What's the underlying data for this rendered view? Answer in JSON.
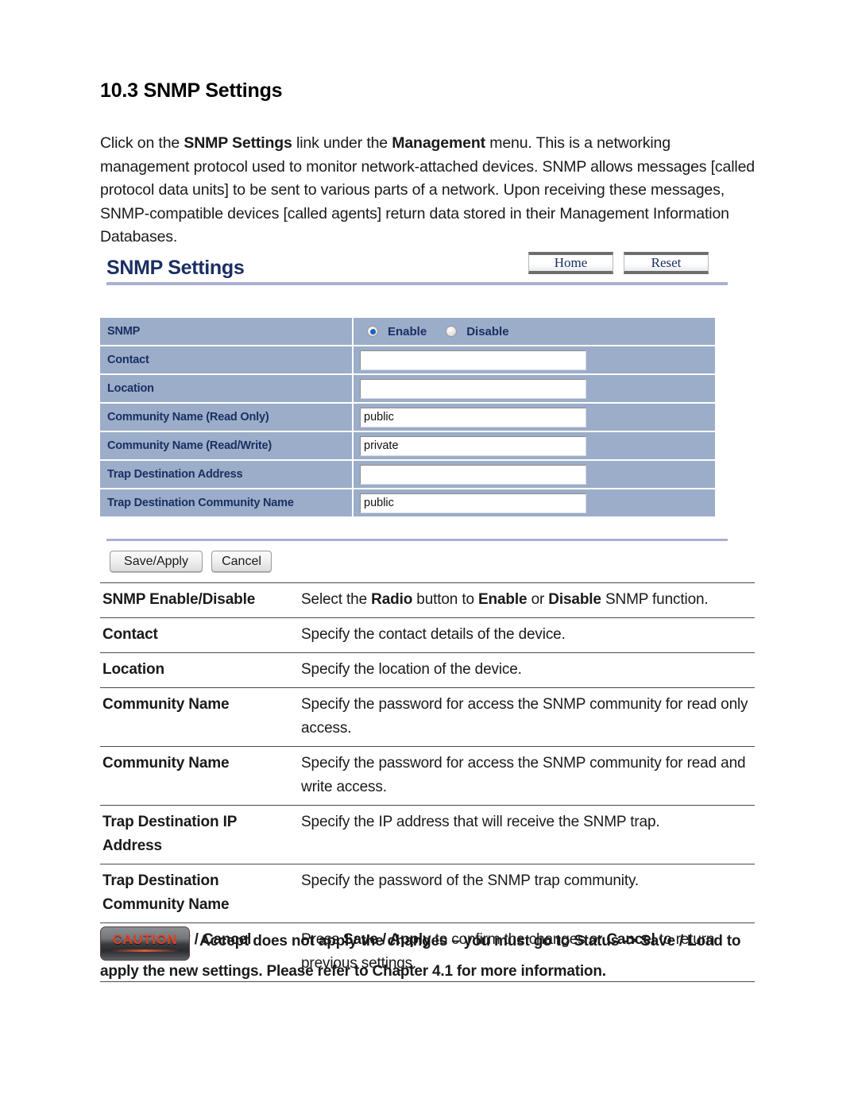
{
  "document": {
    "section_number": "10.3",
    "section_title": "SNMP Settings",
    "heading": "10.3 SNMP Settings",
    "intro_line1_a": "Click on the ",
    "intro_bold1": "SNMP Settings",
    "intro_line1_b": " link under the ",
    "intro_bold2": "Management",
    "intro_line1_c": " menu. This is a networking management protocol used to monitor network-attached devices. SNMP allows messages [called protocol data units] to be sent to various parts of a network. Upon receiving these messages, SNMP-compatible devices [called agents] return data stored in their Management Information Databases."
  },
  "ui": {
    "title": "SNMP Settings",
    "home_button": "Home",
    "reset_button": "Reset",
    "save_button": "Save/Apply",
    "cancel_button": "Cancel",
    "radio": {
      "enable_label": "Enable",
      "disable_label": "Disable",
      "selected": "Enable"
    },
    "rows": [
      {
        "label": "SNMP",
        "type": "radio",
        "value": ""
      },
      {
        "label": "Contact",
        "type": "text",
        "value": ""
      },
      {
        "label": "Location",
        "type": "text",
        "value": ""
      },
      {
        "label": "Community Name (Read Only)",
        "type": "text",
        "value": "public"
      },
      {
        "label": "Community Name (Read/Write)",
        "type": "text",
        "value": "private"
      },
      {
        "label": "Trap Destination Address",
        "type": "text",
        "value": ""
      },
      {
        "label": "Trap Destination Community Name",
        "type": "text",
        "value": "public"
      }
    ]
  },
  "descriptions": [
    {
      "term": "SNMP Enable/Disable",
      "def_parts": [
        {
          "t": "Select the ",
          "b": false
        },
        {
          "t": "Radio",
          "b": true
        },
        {
          "t": " button to ",
          "b": false
        },
        {
          "t": "Enable",
          "b": true
        },
        {
          "t": " or ",
          "b": false
        },
        {
          "t": "Disable",
          "b": true
        },
        {
          "t": " SNMP function.",
          "b": false
        }
      ]
    },
    {
      "term": "Contact",
      "def_parts": [
        {
          "t": "Specify the contact details of the device.",
          "b": false
        }
      ]
    },
    {
      "term": "Location",
      "def_parts": [
        {
          "t": "Specify the location of the device.",
          "b": false
        }
      ]
    },
    {
      "term": "Community Name",
      "def_parts": [
        {
          "t": "Specify the password for access the SNMP community for read only access.",
          "b": false
        }
      ]
    },
    {
      "term": "Community Name",
      "def_parts": [
        {
          "t": "Specify the password for access the SNMP community for read and write access.",
          "b": false
        }
      ]
    },
    {
      "term": "Trap Destination IP Address",
      "def_parts": [
        {
          "t": "Specify the IP address that will receive the SNMP trap.",
          "b": false
        }
      ]
    },
    {
      "term": "Trap Destination Community Name",
      "def_parts": [
        {
          "t": "Specify the password of the SNMP trap community.",
          "b": false
        }
      ]
    },
    {
      "term": "Save / Apply / Cancel",
      "def_parts": [
        {
          "t": "Press ",
          "b": false
        },
        {
          "t": "Save / Apply",
          "b": true
        },
        {
          "t": " to confirm the changes or ",
          "b": false
        },
        {
          "t": "Cancel",
          "b": true
        },
        {
          "t": " to return previous settings.",
          "b": false
        }
      ]
    }
  ],
  "caution": {
    "badge_label": "CAUTION",
    "text": "Accept does not apply the changes – you must go to Status -> Save / Load to apply the new settings. Please refer to Chapter 4.1 for more information."
  },
  "colors": {
    "ui_title": "#1b2f63",
    "table_cell": "#9badc8",
    "rule": "#aab0d2",
    "caution_word": "#d8432a",
    "radio_dot": "#1762c4"
  }
}
